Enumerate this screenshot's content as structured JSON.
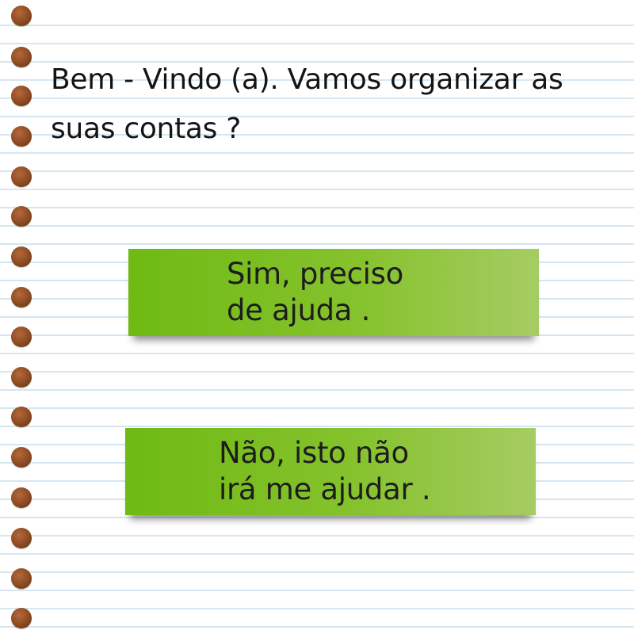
{
  "page": {
    "welcome_text": "Bem - Vindo (a). Vamos organizar as suas contas ?"
  },
  "options": {
    "yes_label": "Sim, preciso\nde ajuda .",
    "no_label": "Não, isto não\nirá me ajudar ."
  },
  "colors": {
    "paper": "#ffffff",
    "rule_lines": "#d6e6f1",
    "binder_holes": "#8c4a22",
    "note_green_left": "#6fba14",
    "note_green_right": "#a6cc62",
    "text": "#141414"
  }
}
